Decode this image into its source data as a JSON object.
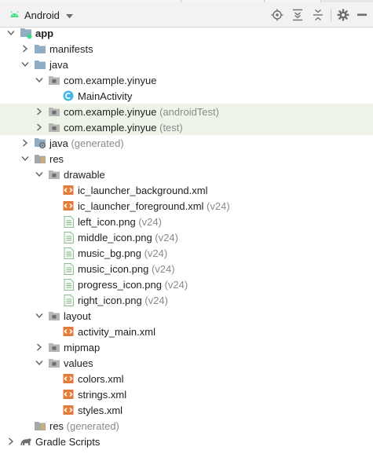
{
  "toolbar": {
    "view_label": "Android",
    "icons": [
      "android-icon",
      "locate-icon",
      "expand-all-icon",
      "collapse-all-icon",
      "gear-icon",
      "hide-icon"
    ]
  },
  "colors": {
    "folder": "#8faec6",
    "android_green": "#3ddc84",
    "xml": "#e27c3c",
    "image": "#8fbf8f",
    "highlight": "#eef5e8",
    "class_badge": "#40b6e0"
  },
  "tree": [
    {
      "label": "app",
      "hint": "",
      "level": 0,
      "expanded": true,
      "icon": "module-icon",
      "bold": true
    },
    {
      "label": "manifests",
      "hint": "",
      "level": 1,
      "expanded": false,
      "icon": "folder-icon"
    },
    {
      "label": "java",
      "hint": "",
      "level": 1,
      "expanded": true,
      "icon": "folder-icon"
    },
    {
      "label": "com.example.yinyue",
      "hint": "",
      "level": 2,
      "expanded": true,
      "icon": "package-icon"
    },
    {
      "label": "MainActivity",
      "hint": "",
      "level": 3,
      "icon": "class-icon"
    },
    {
      "label": "com.example.yinyue",
      "hint": "(androidTest)",
      "level": 2,
      "expanded": false,
      "icon": "package-icon",
      "highlight": true
    },
    {
      "label": "com.example.yinyue",
      "hint": "(test)",
      "level": 2,
      "expanded": false,
      "icon": "package-icon",
      "highlight": true
    },
    {
      "label": "java",
      "hint": "(generated)",
      "level": 1,
      "expanded": false,
      "icon": "generated-folder-icon"
    },
    {
      "label": "res",
      "hint": "",
      "level": 1,
      "expanded": true,
      "icon": "res-folder-icon"
    },
    {
      "label": "drawable",
      "hint": "",
      "level": 2,
      "expanded": true,
      "icon": "package-icon"
    },
    {
      "label": "ic_launcher_background.xml",
      "hint": "",
      "level": 3,
      "icon": "xml-file-icon"
    },
    {
      "label": "ic_launcher_foreground.xml",
      "hint": "(v24)",
      "level": 3,
      "icon": "xml-file-icon"
    },
    {
      "label": "left_icon.png",
      "hint": "(v24)",
      "level": 3,
      "icon": "image-file-icon"
    },
    {
      "label": "middle_icon.png",
      "hint": "(v24)",
      "level": 3,
      "icon": "image-file-icon"
    },
    {
      "label": "music_bg.png",
      "hint": "(v24)",
      "level": 3,
      "icon": "image-file-icon"
    },
    {
      "label": "music_icon.png",
      "hint": "(v24)",
      "level": 3,
      "icon": "image-file-icon"
    },
    {
      "label": "progress_icon.png",
      "hint": "(v24)",
      "level": 3,
      "icon": "image-file-icon"
    },
    {
      "label": "right_icon.png",
      "hint": "(v24)",
      "level": 3,
      "icon": "image-file-icon"
    },
    {
      "label": "layout",
      "hint": "",
      "level": 2,
      "expanded": true,
      "icon": "package-icon"
    },
    {
      "label": "activity_main.xml",
      "hint": "",
      "level": 3,
      "icon": "xml-file-icon"
    },
    {
      "label": "mipmap",
      "hint": "",
      "level": 2,
      "expanded": false,
      "icon": "package-icon"
    },
    {
      "label": "values",
      "hint": "",
      "level": 2,
      "expanded": true,
      "icon": "package-icon"
    },
    {
      "label": "colors.xml",
      "hint": "",
      "level": 3,
      "icon": "xml-file-icon"
    },
    {
      "label": "strings.xml",
      "hint": "",
      "level": 3,
      "icon": "xml-file-icon"
    },
    {
      "label": "styles.xml",
      "hint": "",
      "level": 3,
      "icon": "xml-file-icon"
    },
    {
      "label": "res",
      "hint": "(generated)",
      "level": 1,
      "icon": "res-folder-icon"
    },
    {
      "label": "Gradle Scripts",
      "hint": "",
      "level": 0,
      "expanded": false,
      "icon": "gradle-icon"
    }
  ]
}
